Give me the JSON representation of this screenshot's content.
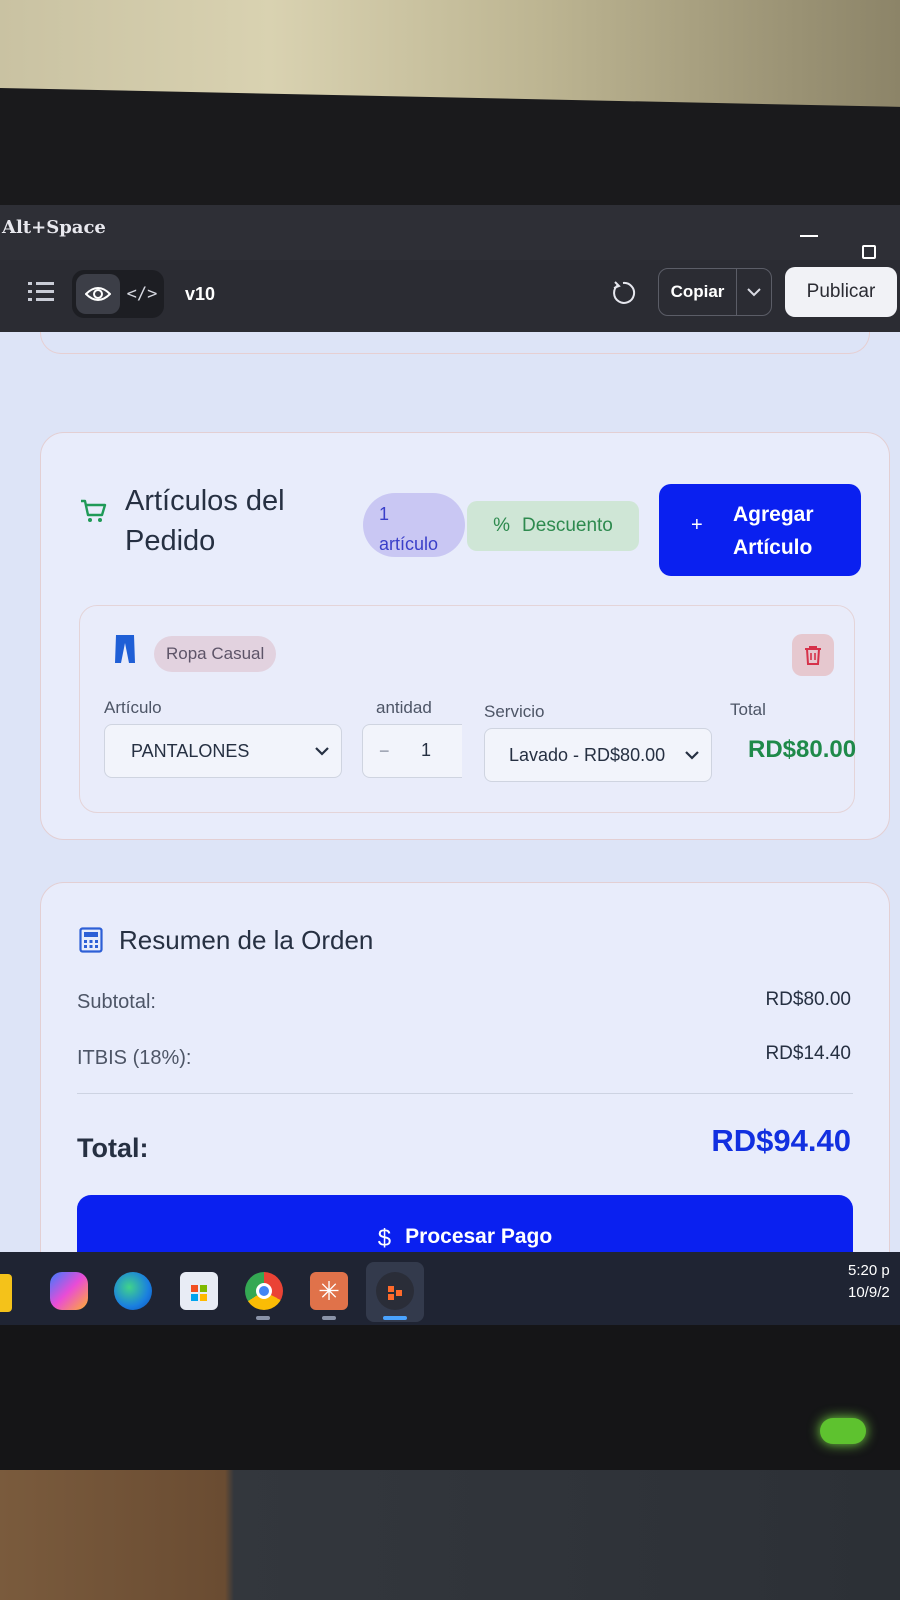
{
  "window": {
    "titlebar_hint": "Alt+Space"
  },
  "toolbar": {
    "version": "v10",
    "copy_label": "Copiar",
    "publish_label": "Publicar"
  },
  "items_card": {
    "title": "Artículos del Pedido",
    "count_number": "1",
    "count_word": "artículo",
    "discount_label": "Descuento",
    "add_label_line1": "Agregar",
    "add_label_line2": "Artículo",
    "item": {
      "category": "Ropa Casual",
      "col_article": "Artículo",
      "col_quantity": "antidad",
      "col_service": "Servicio",
      "col_total": "Total",
      "article_value": "PANTALONES",
      "quantity_value": "1",
      "service_value": "Lavado - RD$80.00",
      "total_value": "RD$80.00"
    }
  },
  "summary_card": {
    "title": "Resumen de la Orden",
    "subtotal_label": "Subtotal:",
    "subtotal_value": "RD$80.00",
    "tax_label": "ITBIS (18%):",
    "tax_value": "RD$14.40",
    "total_label": "Total:",
    "total_value": "RD$94.40",
    "pay_label": "Procesar Pago"
  },
  "taskbar": {
    "time": "5:20 p",
    "date": "10/9/2",
    "apps": [
      "copilot-icon",
      "edge-icon",
      "store-icon",
      "chrome-icon",
      "claude-icon",
      "app-icon"
    ]
  },
  "colors": {
    "primary_blue": "#0a20f0",
    "success_green": "#1f8a4a",
    "toolbar_dark": "#2b2c33"
  }
}
